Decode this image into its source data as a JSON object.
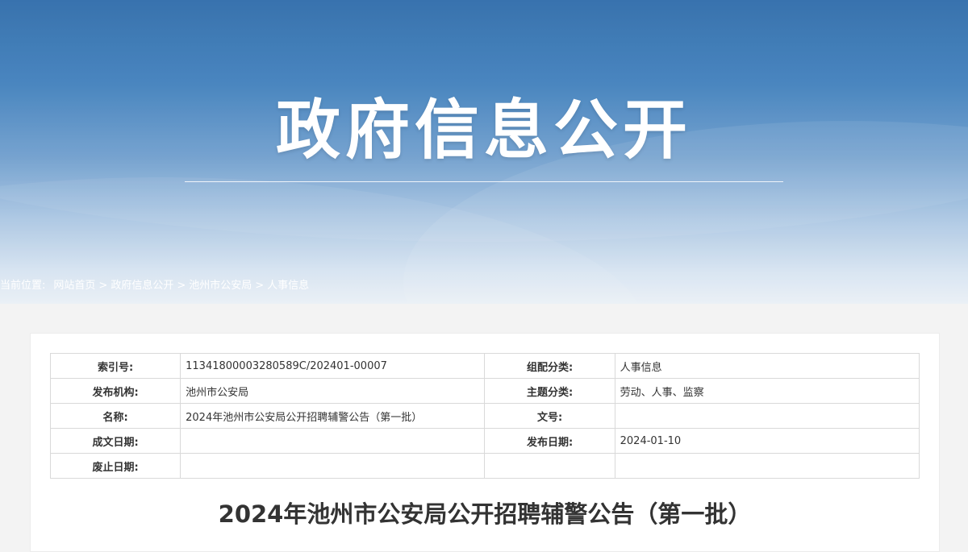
{
  "banner": {
    "title": "政府信息公开"
  },
  "breadcrumb": {
    "prefix": "当前位置:",
    "items": [
      "网站首页",
      "政府信息公开",
      "池州市公安局",
      "人事信息"
    ],
    "separator": ">"
  },
  "meta": {
    "rows": [
      {
        "label1": "索引号:",
        "value1": "11341800003280589C/202401-00007",
        "label2": "组配分类:",
        "value2": "人事信息"
      },
      {
        "label1": "发布机构:",
        "value1": "池州市公安局",
        "label2": "主题分类:",
        "value2": "劳动、人事、监察"
      },
      {
        "label1": "名称:",
        "value1": "2024年池州市公安局公开招聘辅警公告（第一批）",
        "label2": "文号:",
        "value2": ""
      },
      {
        "label1": "成文日期:",
        "value1": "",
        "label2": "发布日期:",
        "value2": "2024-01-10"
      },
      {
        "label1": "废止日期:",
        "value1": "",
        "label2": "",
        "value2": ""
      }
    ]
  },
  "document": {
    "title": "2024年池州市公安局公开招聘辅警公告（第一批）"
  },
  "colors": {
    "banner_top": "#2c6aa9",
    "banner_bottom": "#e9eff6",
    "page_bg": "#f3f3f3",
    "text": "#333333",
    "border": "#d9d9d9"
  }
}
